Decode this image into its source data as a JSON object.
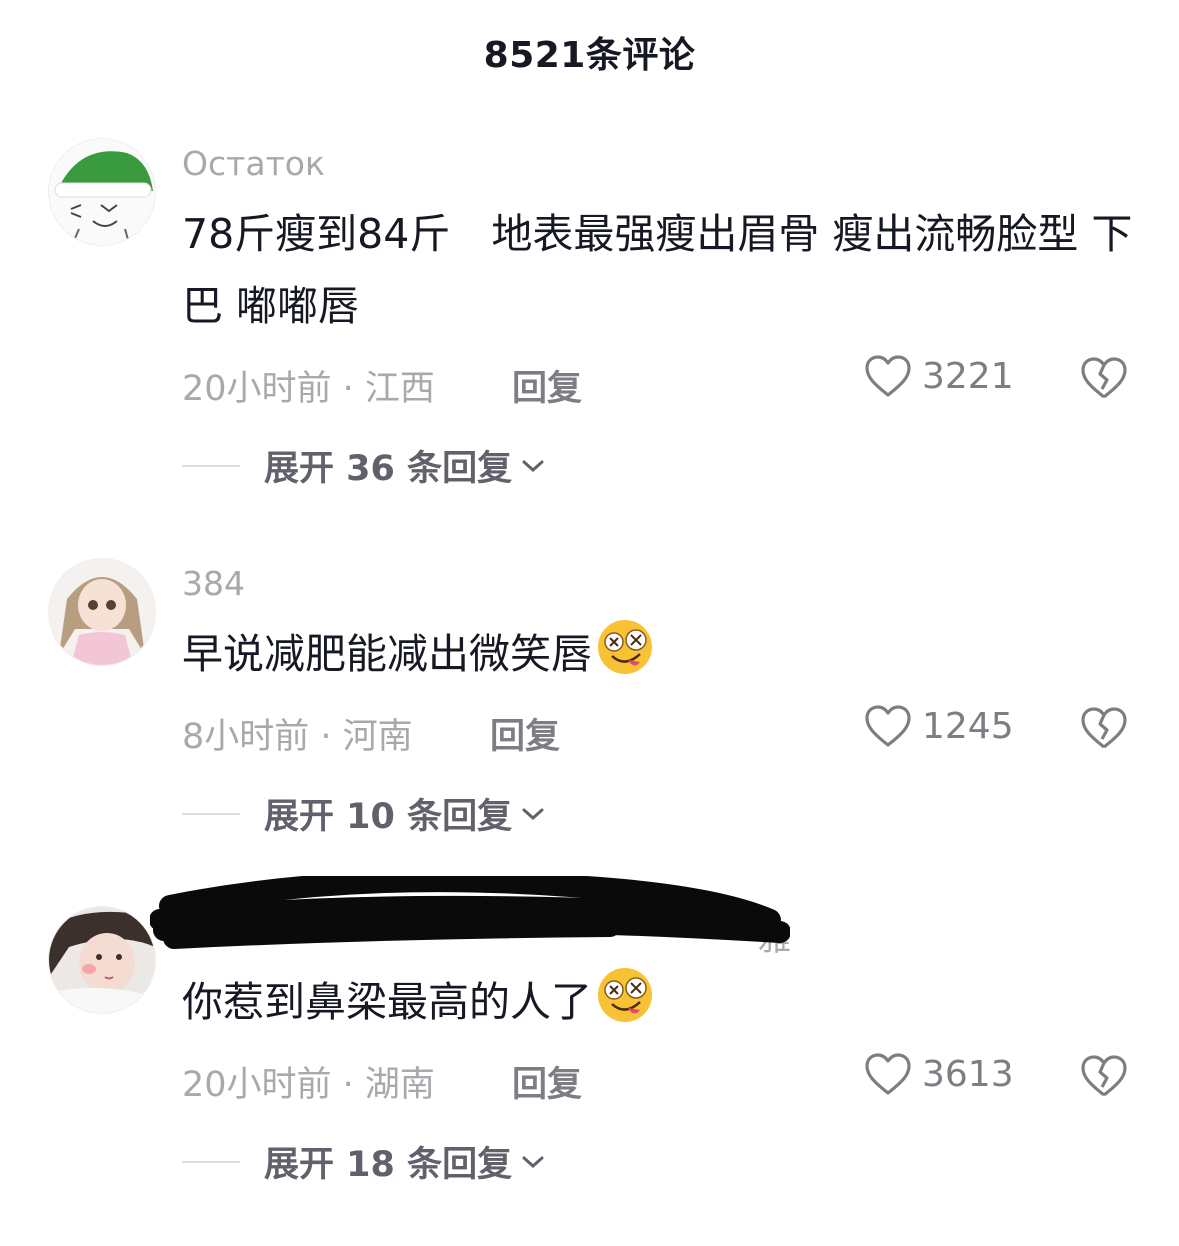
{
  "header": {
    "title": "8521条评论"
  },
  "comments": [
    {
      "username": "Остаток",
      "content": "78斤瘦到84斤　地表最强瘦出眉骨 瘦出流畅脸型  下巴 嘟嘟唇",
      "has_emoji": false,
      "time_location": "20小时前 · 江西",
      "reply_label": "回复",
      "likes": "3221",
      "expand_label": "展开 36 条回复"
    },
    {
      "username": "384",
      "content": "早说减肥能减出微笑唇",
      "has_emoji": true,
      "time_location": "8小时前 · 河南",
      "reply_label": "回复",
      "likes": "1245",
      "expand_label": "展开 10 条回复"
    },
    {
      "username": "雅",
      "content": "你惹到鼻梁最高的人了",
      "has_emoji": true,
      "time_location": "20小时前 · 湖南",
      "reply_label": "回复",
      "likes": "3613",
      "expand_label": "展开 18 条回复"
    }
  ],
  "icons": {
    "like": "heart-outline-icon",
    "dislike": "broken-heart-icon",
    "expand": "chevron-down-icon",
    "emoji": "crazy-face-emoji"
  }
}
